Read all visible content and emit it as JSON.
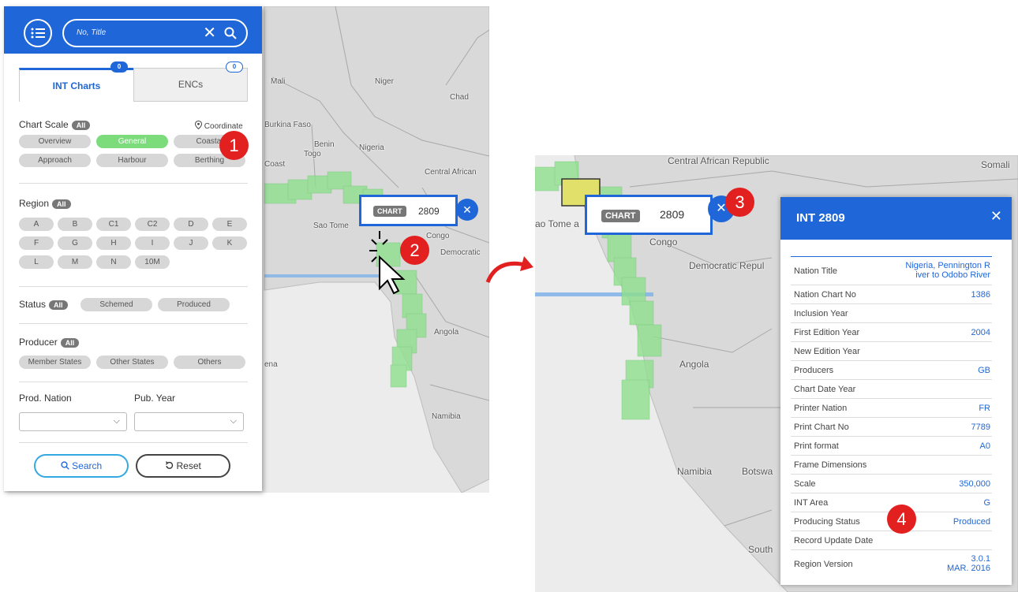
{
  "search": {
    "placeholder": "No, Title"
  },
  "tabs": [
    {
      "label": "INT Charts",
      "count": "0"
    },
    {
      "label": "ENCs",
      "count": "0"
    }
  ],
  "chart_scale": {
    "title": "Chart Scale",
    "all": "All",
    "coordinate": "Coordinate",
    "items": [
      "Overview",
      "General",
      "Coastal",
      "Approach",
      "Harbour",
      "Berthing"
    ],
    "active": "General"
  },
  "region": {
    "title": "Region",
    "all": "All",
    "items": [
      "A",
      "B",
      "C1",
      "C2",
      "D",
      "E",
      "F",
      "G",
      "H",
      "I",
      "J",
      "K",
      "L",
      "M",
      "N",
      "10M"
    ]
  },
  "status": {
    "title": "Status",
    "all": "All",
    "items": [
      "Schemed",
      "Produced"
    ]
  },
  "producer": {
    "title": "Producer",
    "all": "All",
    "items": [
      "Member States",
      "Other States",
      "Others"
    ]
  },
  "filters": {
    "prod_nation": "Prod. Nation",
    "pub_year": "Pub. Year"
  },
  "buttons": {
    "search": "Search",
    "reset": "Reset"
  },
  "markers": [
    "1",
    "2",
    "3",
    "4"
  ],
  "map_left_labels": [
    "Mali",
    "Niger",
    "Chad",
    "Burkina Faso",
    "Benin",
    "Togo",
    "Nigeria",
    "Coast",
    "Central African",
    "Sao Tome",
    "Congo",
    "Democratic",
    "Angola",
    "Namibia",
    "ena"
  ],
  "map_right_labels": [
    "Central African Republic",
    "Somali",
    "ao Tome a",
    "Congo",
    "Democratic Repul",
    "Angola",
    "Namibia",
    "Botswa",
    "South"
  ],
  "chart_popup": {
    "tag": "CHART",
    "number": "2809"
  },
  "info": {
    "title": "INT 2809",
    "rows": [
      {
        "key": "Nation Title",
        "value": "Nigeria, Pennington R\niver to Odobo River"
      },
      {
        "key": "Nation Chart No",
        "value": "1386"
      },
      {
        "key": "Inclusion Year",
        "value": ""
      },
      {
        "key": "First Edition Year",
        "value": "2004"
      },
      {
        "key": "New Edition Year",
        "value": ""
      },
      {
        "key": "Producers",
        "value": "GB"
      },
      {
        "key": "Chart Date Year",
        "value": ""
      },
      {
        "key": "Printer Nation",
        "value": "FR"
      },
      {
        "key": "Print Chart No",
        "value": "7789"
      },
      {
        "key": "Print format",
        "value": "A0"
      },
      {
        "key": "Frame Dimensions",
        "value": ""
      },
      {
        "key": "Scale",
        "value": "350,000"
      },
      {
        "key": "INT Area",
        "value": "G"
      },
      {
        "key": "Producing Status",
        "value": "Produced"
      },
      {
        "key": "Record Update Date",
        "value": ""
      },
      {
        "key": "Region Version",
        "value": "3.0.1\nMAR. 2016"
      }
    ]
  },
  "colors": {
    "primary": "#1f67d8",
    "active_green": "#7cdc7c",
    "marker_red": "#e32020",
    "chart_cell": "#8fe08f"
  }
}
